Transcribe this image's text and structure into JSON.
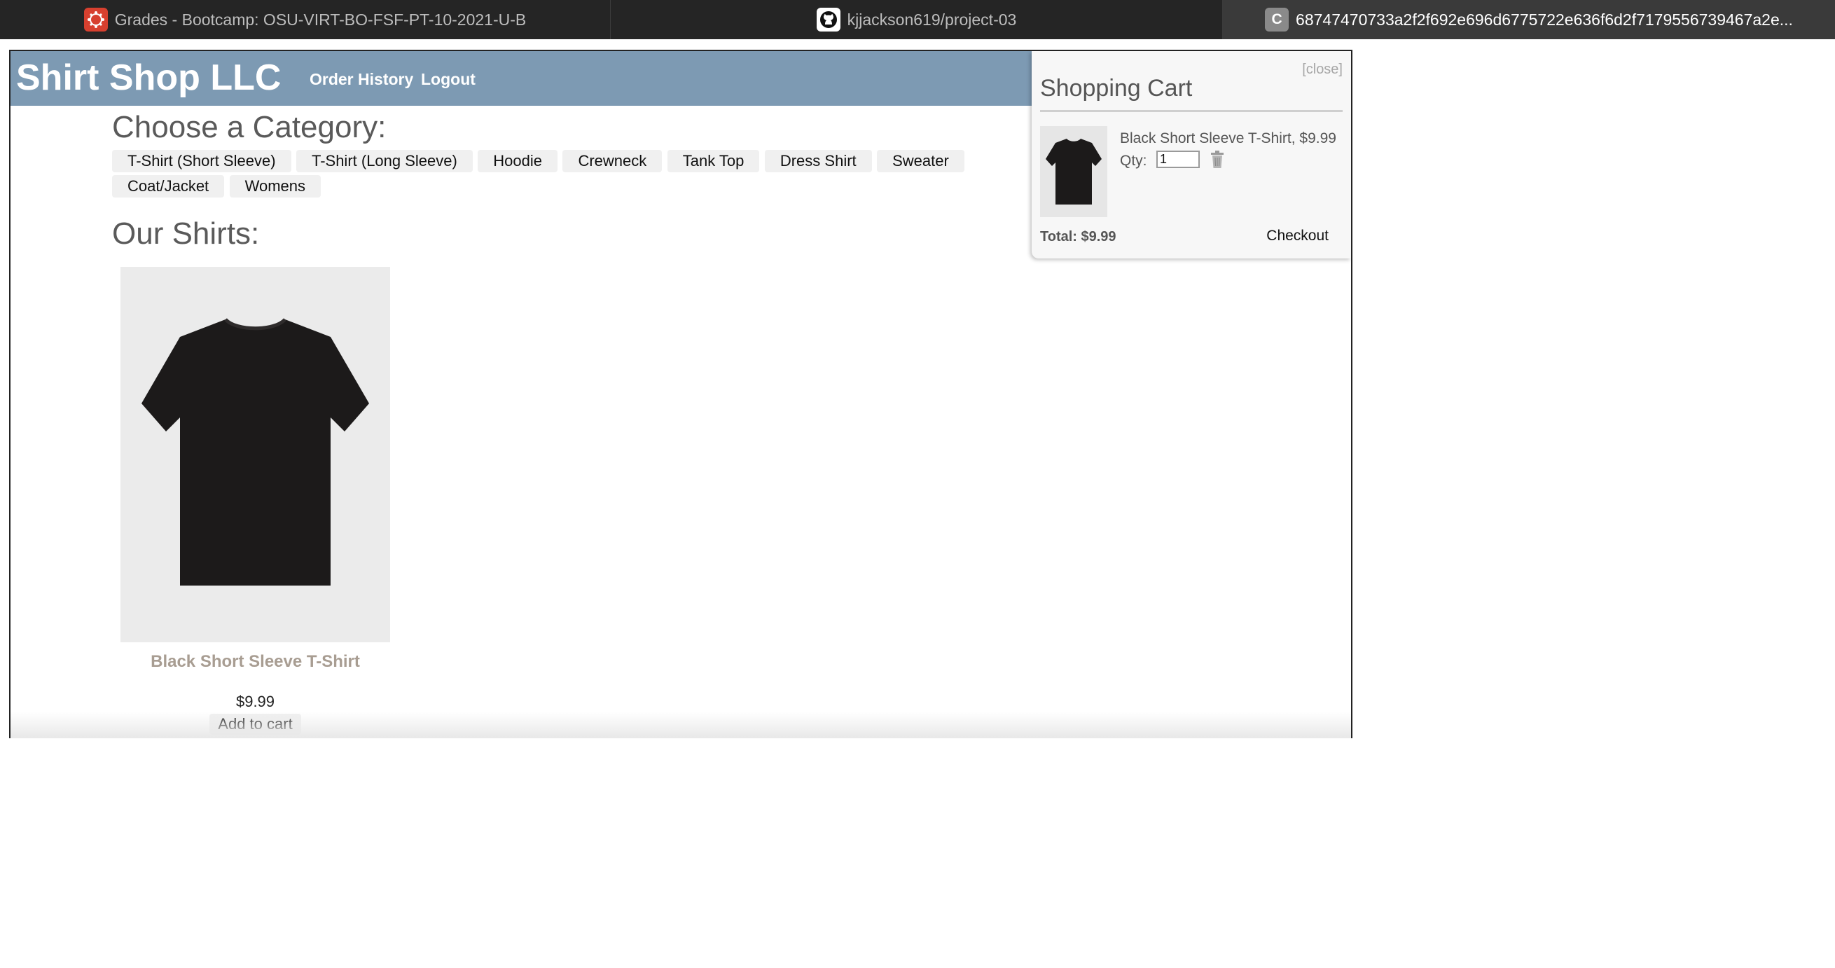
{
  "browser": {
    "tabs": [
      {
        "title": "Grades - Bootcamp: OSU-VIRT-BO-FSF-PT-10-2021-U-B",
        "icon": "canvas-icon"
      },
      {
        "title": "kjjackson619/project-03",
        "icon": "github-icon"
      },
      {
        "title": "68747470733a2f2f692e696d6775722e636f6d2f7179556739467a2e...",
        "icon": "C",
        "active": true
      }
    ]
  },
  "header": {
    "brand": "Shirt Shop LLC",
    "nav": {
      "order_history": "Order History",
      "logout": "Logout"
    },
    "background": "#7d9ab3"
  },
  "categories": {
    "heading": "Choose a Category:",
    "items": [
      "T-Shirt (Short Sleeve)",
      "T-Shirt (Long Sleeve)",
      "Hoodie",
      "Crewneck",
      "Tank Top",
      "Dress Shirt",
      "Sweater",
      "Coat/Jacket",
      "Womens"
    ]
  },
  "products": {
    "heading": "Our Shirts:",
    "items": [
      {
        "name": "Black Short Sleeve T-Shirt",
        "price": "$9.99",
        "button": "Add to cart"
      }
    ]
  },
  "cart": {
    "close": "[close]",
    "title": "Shopping Cart",
    "item": {
      "description": "Black Short Sleeve T-Shirt, $9.99",
      "qty_label": "Qty:",
      "qty": "1"
    },
    "total": "Total: $9.99",
    "checkout": "Checkout"
  }
}
